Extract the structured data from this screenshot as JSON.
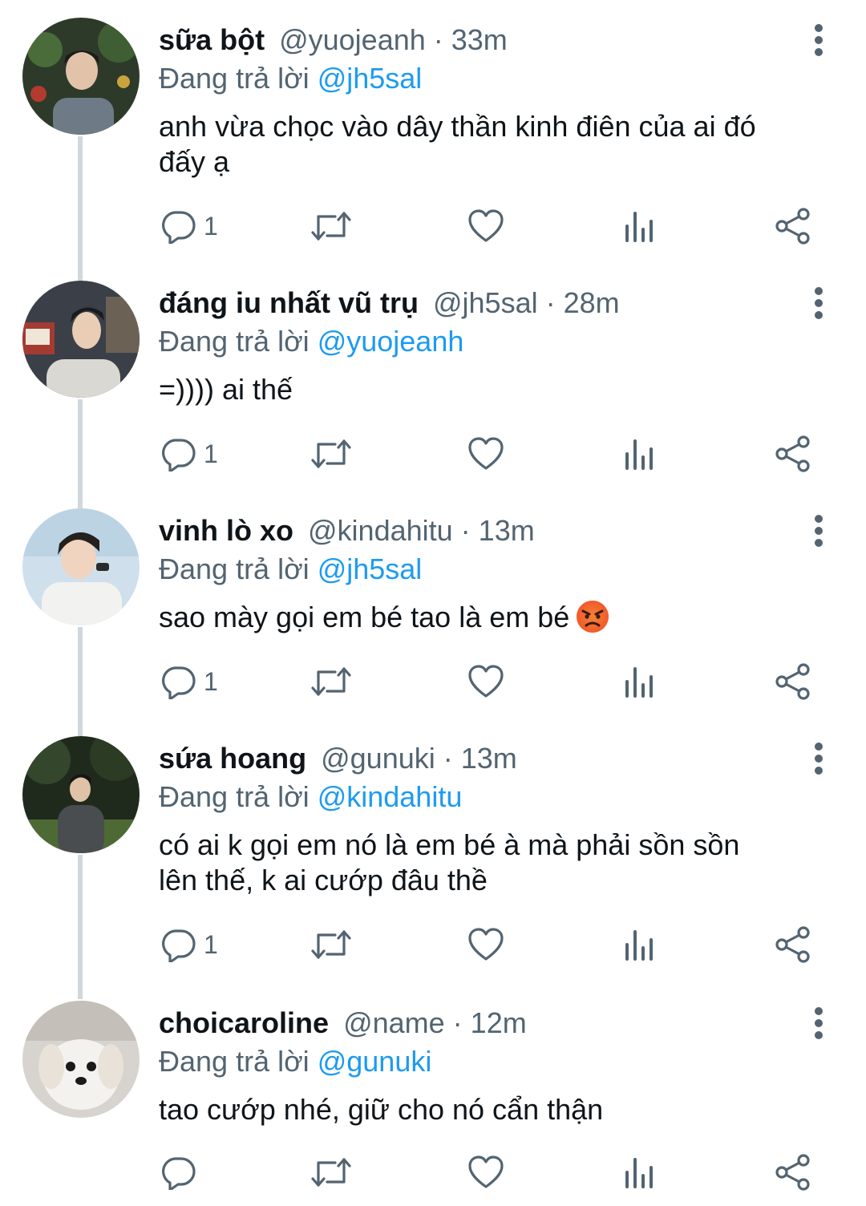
{
  "tweets": [
    {
      "name": "sữa bột",
      "handle": "@yuojeanh",
      "time": "33m",
      "reply_prefix": "Đang trả lời",
      "reply_to": "@jh5sal",
      "text_lines": [
        "anh vừa chọc vào dây thần kinh điên của ai đó",
        "đấy ạ"
      ],
      "reply_count": "1"
    },
    {
      "name": "đáng iu nhất vũ trụ",
      "handle": "@jh5sal",
      "time": "28m",
      "reply_prefix": "Đang trả lời",
      "reply_to": "@yuojeanh",
      "text_lines": [
        "=)))) ai thế"
      ],
      "reply_count": "1"
    },
    {
      "name": "vinh lò xo",
      "handle": "@kindahitu",
      "time": "13m",
      "reply_prefix": "Đang trả lời",
      "reply_to": "@jh5sal",
      "text_lines": [
        "sao mày gọi em bé tao là em bé"
      ],
      "emoji": "angry-face-emoji",
      "reply_count": "1"
    },
    {
      "name": "sứa hoang",
      "handle": "@gunuki",
      "time": "13m",
      "reply_prefix": "Đang trả lời",
      "reply_to": "@kindahitu",
      "text_lines": [
        "có ai k gọi em nó là em bé à mà phải sồn sồn",
        "lên thế, k ai cướp đâu thề"
      ],
      "reply_count": "1"
    },
    {
      "name": "choicaroline",
      "handle": "@name",
      "time": "12m",
      "reply_prefix": "Đang trả lời",
      "reply_to": "@gunuki",
      "text_lines": [
        "tao cướp nhé, giữ cho nó cẩn thận"
      ],
      "reply_count": ""
    }
  ],
  "separator": "·",
  "icons": [
    "reply-icon",
    "retweet-icon",
    "like-icon",
    "views-icon",
    "share-icon",
    "more-options-icon"
  ],
  "colors": {
    "link": "#1d9bf0",
    "secondary": "#536471",
    "primary": "#0f1419",
    "thread_line": "#d0d8de"
  }
}
